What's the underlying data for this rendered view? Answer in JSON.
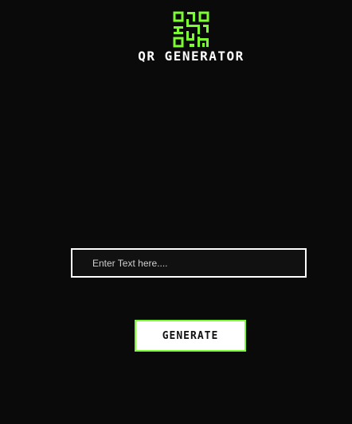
{
  "app": {
    "logo_text": "QR GENERATOR",
    "icon": "qr-code-icon",
    "accent_color": "#7CFC34"
  },
  "form": {
    "input_value": "",
    "input_placeholder": "Enter Text here....",
    "generate_label": "GENERATE"
  }
}
